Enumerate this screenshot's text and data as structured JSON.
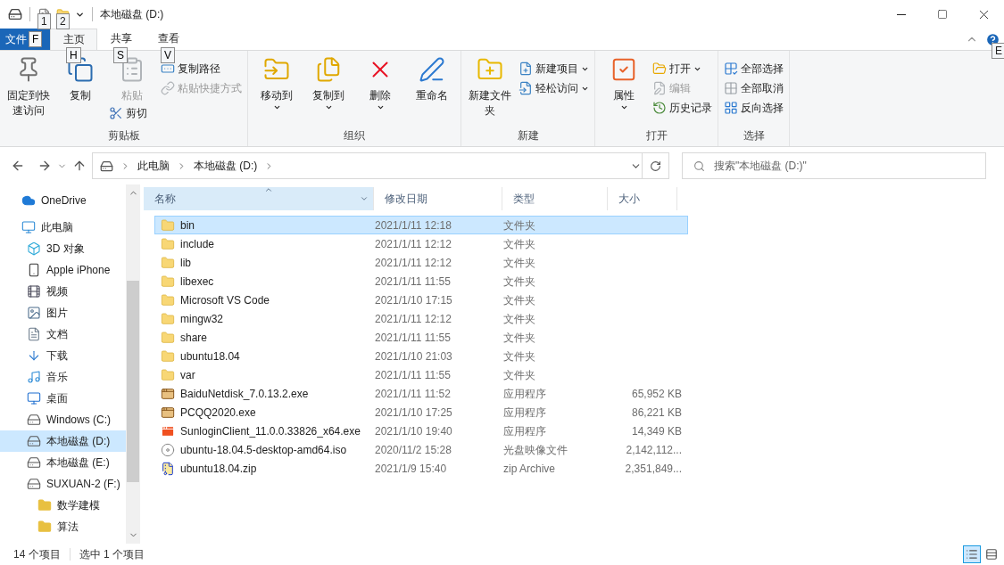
{
  "window": {
    "title": "本地磁盘 (D:)"
  },
  "quick_access_keytips": [
    "1",
    "2"
  ],
  "ribbon_tabs": [
    {
      "label": "文件",
      "keytip": "F",
      "kind": "file",
      "selected": false
    },
    {
      "label": "主页",
      "keytip": "H",
      "kind": "tab",
      "selected": true
    },
    {
      "label": "共享",
      "keytip": "S",
      "kind": "tab",
      "selected": false
    },
    {
      "label": "查看",
      "keytip": "V",
      "kind": "tab",
      "selected": false
    }
  ],
  "help_keytip": "E",
  "ribbon_groups": [
    {
      "label": "剪贴板",
      "columns": [
        [
          {
            "label": "固定到快速访问",
            "kind": "large",
            "disabled": false,
            "dropdown": false
          }
        ],
        [
          {
            "label": "复制",
            "kind": "large",
            "disabled": false,
            "dropdown": false
          }
        ],
        [
          {
            "label": "粘贴",
            "kind": "large",
            "disabled": true,
            "dropdown": false
          },
          {
            "label": "剪切",
            "kind": "small",
            "disabled": false,
            "dropdown": false
          }
        ],
        [
          {
            "label": "复制路径",
            "kind": "small",
            "disabled": false,
            "dropdown": false
          },
          {
            "label": "粘贴快捷方式",
            "kind": "small",
            "disabled": true,
            "dropdown": false
          }
        ]
      ]
    },
    {
      "label": "组织",
      "columns": [
        [
          {
            "label": "移动到",
            "kind": "large",
            "disabled": false,
            "dropdown": true
          }
        ],
        [
          {
            "label": "复制到",
            "kind": "large",
            "disabled": false,
            "dropdown": true
          }
        ],
        [
          {
            "label": "删除",
            "kind": "large",
            "disabled": false,
            "dropdown": true
          }
        ],
        [
          {
            "label": "重命名",
            "kind": "large",
            "disabled": false,
            "dropdown": false
          }
        ]
      ]
    },
    {
      "label": "新建",
      "columns": [
        [
          {
            "label": "新建文件夹",
            "kind": "large",
            "disabled": false,
            "dropdown": false
          }
        ],
        [
          {
            "label": "新建项目",
            "kind": "small",
            "disabled": false,
            "dropdown": true
          },
          {
            "label": "轻松访问",
            "kind": "small",
            "disabled": false,
            "dropdown": true
          }
        ]
      ]
    },
    {
      "label": "打开",
      "columns": [
        [
          {
            "label": "属性",
            "kind": "large",
            "disabled": false,
            "dropdown": true
          }
        ],
        [
          {
            "label": "打开",
            "kind": "small",
            "disabled": false,
            "dropdown": true
          },
          {
            "label": "编辑",
            "kind": "small",
            "disabled": true,
            "dropdown": false
          },
          {
            "label": "历史记录",
            "kind": "small",
            "disabled": false,
            "dropdown": false
          }
        ]
      ]
    },
    {
      "label": "选择",
      "columns": [
        [
          {
            "label": "全部选择",
            "kind": "small",
            "disabled": false,
            "dropdown": false
          },
          {
            "label": "全部取消",
            "kind": "small",
            "disabled": false,
            "dropdown": false
          },
          {
            "label": "反向选择",
            "kind": "small",
            "disabled": false,
            "dropdown": false
          }
        ]
      ]
    }
  ],
  "address_bar": {
    "path": [
      "此电脑",
      "本地磁盘 (D:)"
    ]
  },
  "search": {
    "placeholder": "搜索\"本地磁盘 (D:)\""
  },
  "sidebar": {
    "items": [
      {
        "label": "OneDrive",
        "kind": "cloud",
        "selected": false
      },
      {
        "label": "此电脑",
        "kind": "pc",
        "selected": false,
        "children": [
          {
            "label": "3D 对象",
            "kind": "cube",
            "selected": false
          },
          {
            "label": "Apple iPhone",
            "kind": "phone",
            "selected": false
          },
          {
            "label": "视频",
            "kind": "video",
            "selected": false
          },
          {
            "label": "图片",
            "kind": "picture",
            "selected": false
          },
          {
            "label": "文档",
            "kind": "document",
            "selected": false
          },
          {
            "label": "下载",
            "kind": "download",
            "selected": false
          },
          {
            "label": "音乐",
            "kind": "music",
            "selected": false
          },
          {
            "label": "桌面",
            "kind": "desktop",
            "selected": false
          },
          {
            "label": "Windows (C:)",
            "kind": "drive",
            "selected": false
          },
          {
            "label": "本地磁盘 (D:)",
            "kind": "drive",
            "selected": true
          },
          {
            "label": "本地磁盘 (E:)",
            "kind": "drive",
            "selected": false
          },
          {
            "label": "SUXUAN-2 (F:)",
            "kind": "drive",
            "selected": false,
            "children": [
              {
                "label": "数学建模",
                "kind": "folder",
                "selected": false
              },
              {
                "label": "算法",
                "kind": "folder",
                "selected": false
              }
            ]
          }
        ]
      }
    ]
  },
  "table": {
    "columns": [
      {
        "label": "名称",
        "sorted": true
      },
      {
        "label": "修改日期",
        "sorted": false
      },
      {
        "label": "类型",
        "sorted": false
      },
      {
        "label": "大小",
        "sorted": false
      }
    ],
    "rows": [
      {
        "name": "bin",
        "date": "2021/1/11 12:18",
        "type": "文件夹",
        "kind": "folder",
        "selected": true
      },
      {
        "name": "include",
        "date": "2021/1/11 12:12",
        "type": "文件夹",
        "kind": "folder",
        "selected": false
      },
      {
        "name": "lib",
        "date": "2021/1/11 12:12",
        "type": "文件夹",
        "kind": "folder",
        "selected": false
      },
      {
        "name": "libexec",
        "date": "2021/1/11 11:55",
        "type": "文件夹",
        "kind": "folder",
        "selected": false
      },
      {
        "name": "Microsoft VS Code",
        "date": "2021/1/10 17:15",
        "type": "文件夹",
        "kind": "folder",
        "selected": false
      },
      {
        "name": "mingw32",
        "date": "2021/1/11 12:12",
        "type": "文件夹",
        "kind": "folder",
        "selected": false
      },
      {
        "name": "share",
        "date": "2021/1/11 11:55",
        "type": "文件夹",
        "kind": "folder",
        "selected": false
      },
      {
        "name": "ubuntu18.04",
        "date": "2021/1/10 21:03",
        "type": "文件夹",
        "kind": "folder",
        "selected": false
      },
      {
        "name": "var",
        "date": "2021/1/11 11:55",
        "type": "文件夹",
        "kind": "folder",
        "selected": false
      },
      {
        "name": "BaiduNetdisk_7.0.13.2.exe",
        "date": "2021/1/11 11:52",
        "type": "应用程序",
        "size": "65,952 KB",
        "kind": "app",
        "selected": false
      },
      {
        "name": "PCQQ2020.exe",
        "date": "2021/1/10 17:25",
        "type": "应用程序",
        "size": "86,221 KB",
        "kind": "app",
        "selected": false
      },
      {
        "name": "SunloginClient_11.0.0.33826_x64.exe",
        "date": "2021/1/10 19:40",
        "type": "应用程序",
        "size": "14,349 KB",
        "kind": "app-red",
        "selected": false
      },
      {
        "name": "ubuntu-18.04.5-desktop-amd64.iso",
        "date": "2020/11/2 15:28",
        "type": "光盘映像文件",
        "size": "2,142,112...",
        "kind": "disc",
        "selected": false
      },
      {
        "name": "ubuntu18.04.zip",
        "date": "2021/1/9 15:40",
        "type": "zip Archive",
        "size": "2,351,849...",
        "kind": "zip",
        "selected": false
      }
    ]
  },
  "status_bar": {
    "item_count": "14 个项目",
    "selection": "选中 1 个项目",
    "view_buttons": [
      {
        "kind": "details",
        "selected": true
      },
      {
        "kind": "large-icons",
        "selected": false
      }
    ]
  }
}
